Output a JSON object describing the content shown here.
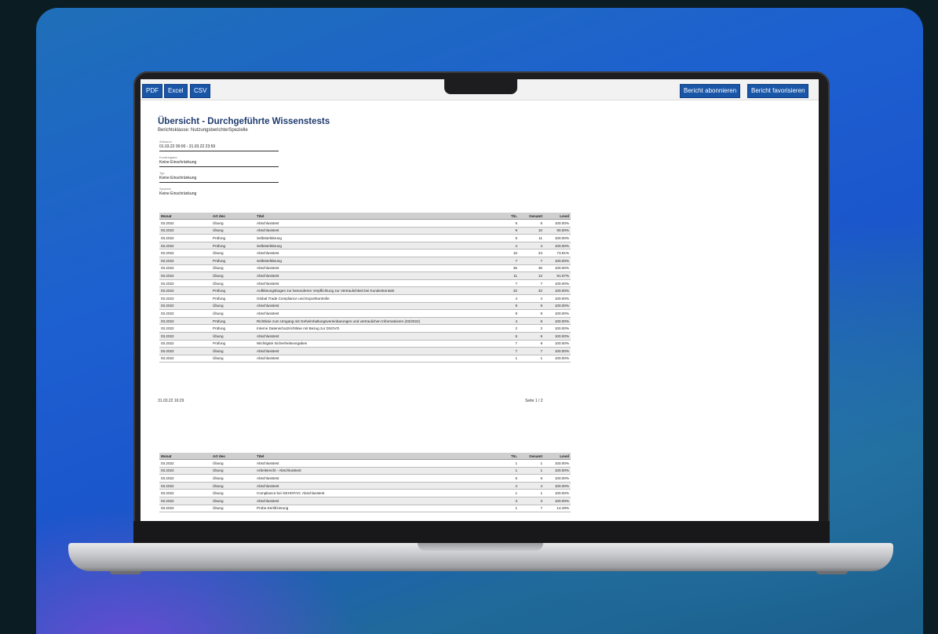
{
  "toolbar": {
    "export_buttons": [
      "PDF",
      "Excel",
      "CSV"
    ],
    "subscribe_label": "Bericht abonnieren",
    "favorite_label": "Bericht favorisieren"
  },
  "report": {
    "title": "Übersicht - Durchgeführte Wissenstests",
    "subtitle": "Berichtsklasse: Nutzungsberichte/Spezielle",
    "filters": [
      {
        "label": "Zeitraum",
        "value": "01.03.22 00:00 - 31.03.22 23:59"
      },
      {
        "label": "Kursfreigabe",
        "value": "Keine Einschränkung"
      },
      {
        "label": "Typ",
        "value": "Keine Einschränkung"
      },
      {
        "label": "Sprache",
        "value": "Keine Einschränkung"
      }
    ],
    "columns": [
      "Monat",
      "Art des",
      "Titel",
      "Tln.",
      "Gesamt",
      "Level"
    ],
    "page1_rows": [
      [
        "03.2022",
        "Übung",
        "Abschlusstest",
        "6",
        "6",
        "100.00%"
      ],
      [
        "03.2022",
        "Übung",
        "Abschlusstest",
        "9",
        "10",
        "90.00%"
      ],
      [
        "03.2022",
        "Prüfung",
        "Selbsterklärung",
        "5",
        "11",
        "100.00%"
      ],
      [
        "03.2022",
        "Prüfung",
        "Selbsterklärung",
        "4",
        "4",
        "100.00%"
      ],
      [
        "03.2022",
        "Übung",
        "Abschlusstest",
        "16",
        "23",
        "73.91%"
      ],
      [
        "03.2022",
        "Prüfung",
        "Selbsterklärung",
        "7",
        "7",
        "100.00%"
      ],
      [
        "03.2022",
        "Übung",
        "Abschlusstest",
        "35",
        "35",
        "100.00%"
      ],
      [
        "03.2022",
        "Übung",
        "Abschlusstest",
        "11",
        "12",
        "91.67%"
      ],
      [
        "03.2022",
        "Übung",
        "Abschlusstest",
        "7",
        "7",
        "100.00%"
      ],
      [
        "03.2022",
        "Prüfung",
        "Aufklärungsbogen zur besonderen Verpflichtung zur Vertraulichkeit bei Kundenkontakt",
        "32",
        "32",
        "100.00%"
      ],
      [
        "03.2022",
        "Prüfung",
        "Global Trade Compliance und Exportkontrolle",
        "4",
        "4",
        "100.00%"
      ],
      [
        "03.2022",
        "Übung",
        "Abschlusstest",
        "9",
        "9",
        "100.00%"
      ],
      [
        "03.2022",
        "Übung",
        "Abschlusstest",
        "9",
        "9",
        "100.00%"
      ],
      [
        "03.2022",
        "Prüfung",
        "Richtlinie zum Umgang mit Geheimhaltungsvereinbarungen und vertraulichen Informationen (03/2022)",
        "4",
        "6",
        "100.00%"
      ],
      [
        "03.2022",
        "Prüfung",
        "Interne Datenschutzrichtlinie mit Bezug zur DSGVO",
        "2",
        "2",
        "100.00%"
      ],
      [
        "03.2022",
        "Übung",
        "Abschlusstest",
        "6",
        "6",
        "100.00%"
      ],
      [
        "03.2022",
        "Prüfung",
        "Wichtigste Sicherheitsvorgaben",
        "7",
        "9",
        "100.00%"
      ],
      [
        "03.2022",
        "Übung",
        "Abschlusstest",
        "7",
        "7",
        "100.00%"
      ],
      [
        "03.2022",
        "Übung",
        "Abschlusstest",
        "1",
        "1",
        "100.00%"
      ]
    ],
    "footer_timestamp": "31.03.22 16:29",
    "footer_page": "Seite 1 / 2",
    "page2_rows": [
      [
        "03.2022",
        "Übung",
        "Abschlusstest",
        "1",
        "1",
        "100.00%"
      ],
      [
        "03.2022",
        "Übung",
        "Arbeitsrecht - Abschlusstest",
        "1",
        "1",
        "100.00%"
      ],
      [
        "03.2022",
        "Übung",
        "Abschlusstest",
        "6",
        "6",
        "100.00%"
      ],
      [
        "03.2022",
        "Übung",
        "Abschlusstest",
        "4",
        "4",
        "100.00%"
      ],
      [
        "03.2022",
        "Übung",
        "Compliance bei GEHOFAG: Abschlusstest",
        "1",
        "1",
        "100.00%"
      ],
      [
        "03.2022",
        "Übung",
        "Abschlusstest",
        "3",
        "3",
        "100.00%"
      ],
      [
        "03.2022",
        "Übung",
        "Probe-Zertifizierung",
        "1",
        "7",
        "14.29%"
      ]
    ]
  }
}
